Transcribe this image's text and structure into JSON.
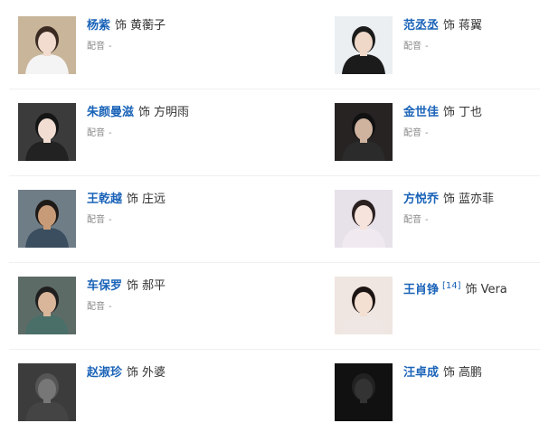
{
  "cast": [
    {
      "actor": "杨紫",
      "as": "饰",
      "role": "黄蘅子",
      "dub_label": "配音",
      "dub_value": "-",
      "ref": "",
      "photo": {
        "bg": "#c8b59a",
        "hair": "#3a2a22",
        "skin": "#f2dccf",
        "top": "#f4f4f4"
      }
    },
    {
      "actor": "范丞丞",
      "as": "饰",
      "role": "蒋翼",
      "dub_label": "配音",
      "dub_value": "-",
      "ref": "",
      "photo": {
        "bg": "#eceff2",
        "hair": "#1b1b1b",
        "skin": "#f0d8c8",
        "top": "#1b1b1b"
      }
    },
    {
      "actor": "朱颜曼滋",
      "as": "饰",
      "role": "方明雨",
      "dub_label": "配音",
      "dub_value": "-",
      "ref": "",
      "photo": {
        "bg": "#3b3b3b",
        "hair": "#151515",
        "skin": "#f1ddd2",
        "top": "#222222"
      }
    },
    {
      "actor": "金世佳",
      "as": "饰",
      "role": "丁也",
      "dub_label": "配音",
      "dub_value": "-",
      "ref": "",
      "photo": {
        "bg": "#262322",
        "hair": "#111111",
        "skin": "#cfb39f",
        "top": "#2b2b2b"
      }
    },
    {
      "actor": "王乾越",
      "as": "饰",
      "role": "庄远",
      "dub_label": "配音",
      "dub_value": "-",
      "ref": "",
      "photo": {
        "bg": "#6f7d87",
        "hair": "#1e1a17",
        "skin": "#c79b78",
        "top": "#3b4e5f"
      }
    },
    {
      "actor": "方悦乔",
      "as": "饰",
      "role": "蓝亦菲",
      "dub_label": "配音",
      "dub_value": "-",
      "ref": "",
      "photo": {
        "bg": "#e7e1ea",
        "hair": "#2a2020",
        "skin": "#f5e3dc",
        "top": "#f0eaf0"
      }
    },
    {
      "actor": "车保罗",
      "as": "饰",
      "role": "郝平",
      "dub_label": "配音",
      "dub_value": "-",
      "ref": "",
      "photo": {
        "bg": "#5d6b66",
        "hair": "#1f1f1f",
        "skin": "#d9b59a",
        "top": "#4a6f68"
      }
    },
    {
      "actor": "王肖铮",
      "as": "饰",
      "role": "Vera",
      "dub_label": "",
      "dub_value": "",
      "ref": "[14]",
      "photo": {
        "bg": "#f0e6e1",
        "hair": "#1c1412",
        "skin": "#f4dfd3",
        "top": "#efe7e3"
      }
    },
    {
      "actor": "赵淑珍",
      "as": "饰",
      "role": "外婆",
      "dub_label": "",
      "dub_value": "",
      "ref": "",
      "photo": {
        "bg": "#3c3c3c",
        "hair": "#555",
        "skin": "#777",
        "top": "#444"
      }
    },
    {
      "actor": "汪卓成",
      "as": "饰",
      "role": "高鹏",
      "dub_label": "",
      "dub_value": "",
      "ref": "",
      "photo": {
        "bg": "#111111",
        "hair": "#222",
        "skin": "#333",
        "top": "#111"
      }
    }
  ]
}
